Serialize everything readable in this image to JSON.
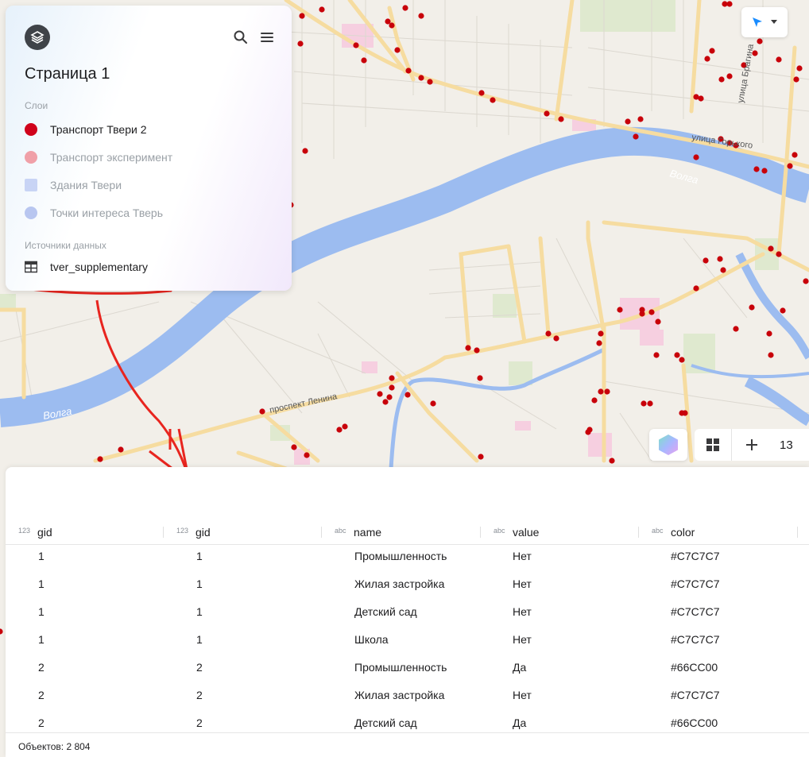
{
  "app": {
    "page_title": "Страница 1",
    "search_icon": "search-icon",
    "menu_icon": "hamburger-menu-icon"
  },
  "layers": {
    "section_label": "Слои",
    "items": [
      {
        "label": "Транспорт Твери 2",
        "marker": "circle",
        "color": "#d0021b",
        "active": true
      },
      {
        "label": "Транспорт эксперимент",
        "marker": "circle",
        "color": "#f0a0a8",
        "active": false
      },
      {
        "label": "Здания Твери",
        "marker": "square",
        "color": "#c8d4f5",
        "active": false
      },
      {
        "label": "Точки интереса Тверь",
        "marker": "circle",
        "color": "#b8c6f0",
        "active": false
      }
    ]
  },
  "sources": {
    "section_label": "Источники данных",
    "items": [
      {
        "label": "tver_supplementary",
        "icon": "table-icon"
      }
    ]
  },
  "map": {
    "labels": {
      "volga_1": "Волга",
      "volga_2": "Волга",
      "street_1": "улица Горького",
      "street_2": "проспект Ленина",
      "street_3": "улица Брагина"
    },
    "zoom_level": "13",
    "controls": {
      "nav_icon": "cursor-arrow-icon",
      "style_icon": "hexagon-style-icon",
      "basemap_icon": "grid-icon",
      "zoom_in_icon": "plus-icon"
    },
    "colors": {
      "water": "#9cbcf0",
      "road": "#f6dca0",
      "point": "#c8000a",
      "annotation": "#e8251f"
    }
  },
  "table": {
    "columns": [
      {
        "type": "123",
        "name": "gid"
      },
      {
        "type": "123",
        "name": "gid"
      },
      {
        "type": "abc",
        "name": "name"
      },
      {
        "type": "abc",
        "name": "value"
      },
      {
        "type": "abc",
        "name": "color"
      }
    ],
    "rows": [
      [
        "1",
        "1",
        "Промышленность",
        "Нет",
        "#C7C7C7"
      ],
      [
        "1",
        "1",
        "Жилая застройка",
        "Нет",
        "#C7C7C7"
      ],
      [
        "1",
        "1",
        "Детский сад",
        "Нет",
        "#C7C7C7"
      ],
      [
        "1",
        "1",
        "Школа",
        "Нет",
        "#C7C7C7"
      ],
      [
        "2",
        "2",
        "Промышленность",
        "Да",
        "#66CC00"
      ],
      [
        "2",
        "2",
        "Жилая застройка",
        "Нет",
        "#C7C7C7"
      ],
      [
        "2",
        "2",
        "Детский сад",
        "Да",
        "#66CC00"
      ]
    ],
    "footer": "Объектов: 2 804"
  }
}
